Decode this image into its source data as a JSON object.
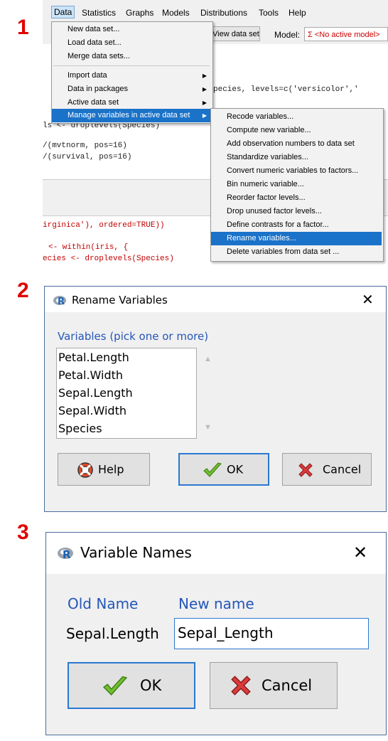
{
  "steps": [
    "1",
    "2",
    "3"
  ],
  "menubar": [
    "Data",
    "Statistics",
    "Graphs",
    "Models",
    "Distributions",
    "Tools",
    "Help"
  ],
  "toolbar": {
    "view_button": "View data set",
    "model_label": "Model:",
    "model_value": "Σ <No active model>"
  },
  "script_code": [
    "pecies, levels=c('versicolor','",
    "ls <- droplevels(Species)",
    "/(mvtnorm, pos=16)",
    "/(survival, pos=16)"
  ],
  "output_code": [
    "irginica'), ordered=TRUE))",
    "<- within(iris, {",
    "ecies <- droplevels(Species)"
  ],
  "data_menu": [
    "New data set...",
    "Load data set...",
    "Merge data sets...",
    "Import data",
    "Data in packages",
    "Active data set",
    "Manage variables in active data set"
  ],
  "submenu": [
    "Recode variables...",
    "Compute new variable...",
    "Add observation numbers to data set",
    "Standardize variables...",
    "Convert numeric variables to factors...",
    "Bin numeric variable...",
    "Reorder factor levels...",
    "Drop unused factor levels...",
    "Define contrasts for a factor...",
    "Rename variables...",
    "Delete variables from data set ..."
  ],
  "rename_dialog": {
    "title": "Rename Variables",
    "list_label": "Variables (pick one or more)",
    "variables": [
      "Petal.Length",
      "Petal.Width",
      "Sepal.Length",
      "Sepal.Width",
      "Species"
    ],
    "help": "Help",
    "ok": "OK",
    "cancel": "Cancel"
  },
  "names_dialog": {
    "title": "Variable Names",
    "old_header": "Old Name",
    "new_header": "New name",
    "old_value": "Sepal.Length",
    "new_value": "Sepal_Length",
    "ok": "OK",
    "cancel": "Cancel"
  },
  "colors": {
    "step_red": "#e00000",
    "menu_highlight": "#1a72c9",
    "label_blue": "#2456b8"
  }
}
